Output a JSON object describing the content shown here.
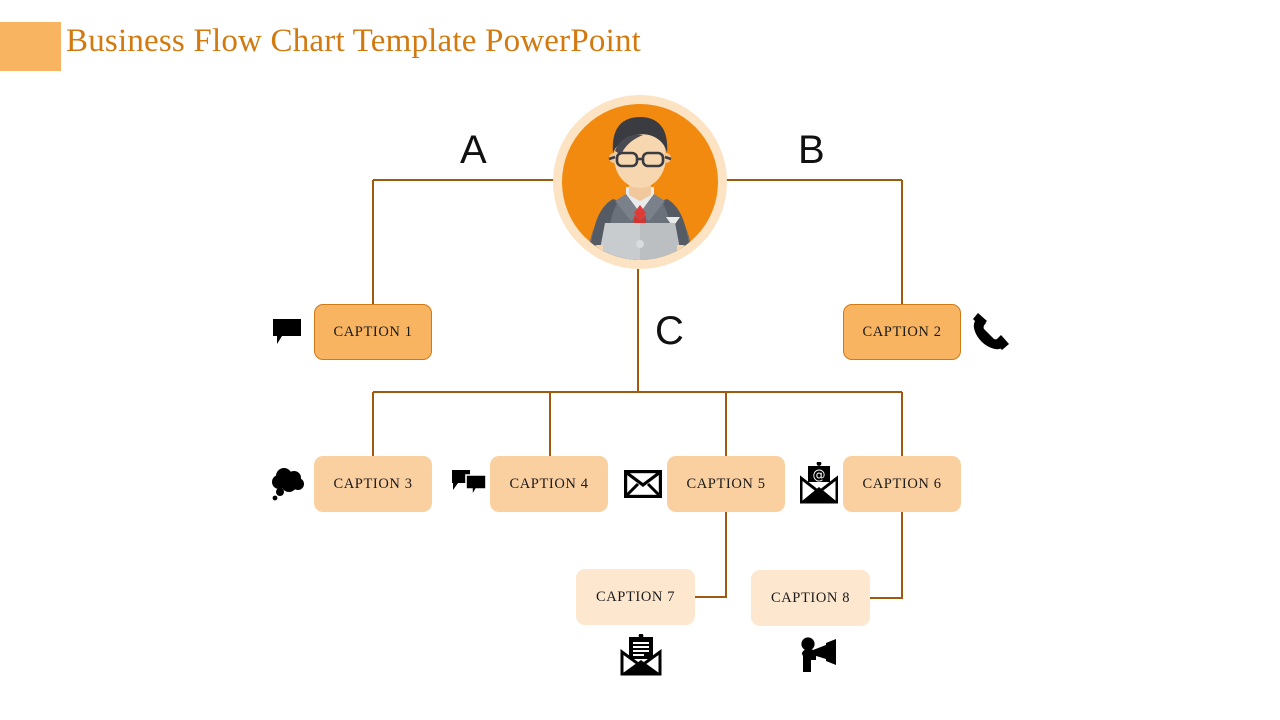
{
  "header": {
    "title": "Business Flow Chart Template PowerPoint",
    "accent_color": "#f8b461",
    "title_color": "#d2790f"
  },
  "colors": {
    "line": "#a05a10",
    "avatar_ring": "#fbe3c4",
    "avatar_circle": "#f28a0f",
    "tier1_fill": "#f8b461",
    "tier1_border": "#cf7a15",
    "tier2_fill": "#fbd0a0",
    "tier3_fill": "#fde8cf",
    "icon": "#000000",
    "letter": "#111111"
  },
  "avatar": {
    "name": "businessman-with-laptop",
    "skin": "#f7d7b0",
    "hair": "#3b3b42",
    "glasses": "#3b3b42",
    "suit": "#6b717a",
    "suit_dark": "#565c66",
    "shirt": "#e9eaec",
    "tie": "#e03a36",
    "laptop": "#c9ccce",
    "laptop_dark": "#b2b5b8"
  },
  "branches": [
    {
      "id": "a",
      "label": "A"
    },
    {
      "id": "b",
      "label": "B"
    },
    {
      "id": "c",
      "label": "C"
    }
  ],
  "nodes": [
    {
      "id": "caption-1",
      "label": "CAPTION 1",
      "tier": 1,
      "icon": "speech-bubble-icon",
      "icon_side": "left"
    },
    {
      "id": "caption-2",
      "label": "CAPTION 2",
      "tier": 1,
      "icon": "phone-handset-icon",
      "icon_side": "right"
    },
    {
      "id": "caption-3",
      "label": "CAPTION 3",
      "tier": 2,
      "icon": "thought-bubble-icon",
      "icon_side": "left"
    },
    {
      "id": "caption-4",
      "label": "CAPTION 4",
      "tier": 2,
      "icon": "chat-bubbles-icon",
      "icon_side": "left"
    },
    {
      "id": "caption-5",
      "label": "CAPTION 5",
      "tier": 2,
      "icon": "envelope-icon",
      "icon_side": "left"
    },
    {
      "id": "caption-6",
      "label": "CAPTION 6",
      "tier": 2,
      "icon": "email-at-icon",
      "icon_side": "left"
    },
    {
      "id": "caption-7",
      "label": "CAPTION 7",
      "tier": 3,
      "icon": "open-envelope-letter-icon",
      "icon_side": "below"
    },
    {
      "id": "caption-8",
      "label": "CAPTION 8",
      "tier": 3,
      "icon": "megaphone-person-icon",
      "icon_side": "below"
    }
  ],
  "chart_data": {
    "type": "diagram",
    "title": "Business Flow Chart Template PowerPoint",
    "root": "businessman-with-laptop",
    "branch_labels": [
      "A",
      "B",
      "C"
    ],
    "edges": [
      {
        "from": "root",
        "to": "caption-1",
        "branch": "A"
      },
      {
        "from": "root",
        "to": "caption-2",
        "branch": "B"
      },
      {
        "from": "root",
        "to": "caption-3",
        "branch": "C"
      },
      {
        "from": "root",
        "to": "caption-4",
        "branch": "C"
      },
      {
        "from": "root",
        "to": "caption-5",
        "branch": "C"
      },
      {
        "from": "root",
        "to": "caption-6",
        "branch": "C"
      },
      {
        "from": "caption-5",
        "to": "caption-7"
      },
      {
        "from": "caption-6",
        "to": "caption-8"
      }
    ]
  }
}
